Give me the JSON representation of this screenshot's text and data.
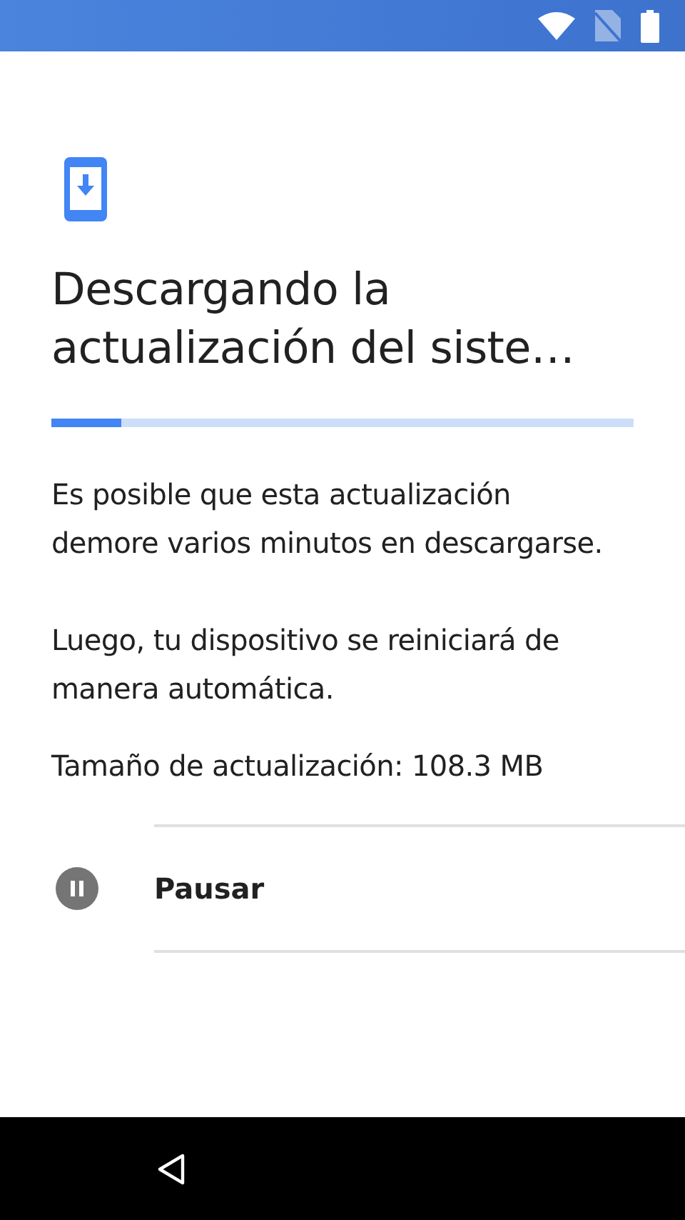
{
  "title": "Descargando la actualización del siste…",
  "progress": {
    "level": 0.12
  },
  "paragraphs": [
    "Es posible que esta actualización demore varios minutos en descargarse.",
    "Luego, tu dispositivo se reiniciará de manera automática.",
    "Tamaño de actualización: 108.3 MB"
  ],
  "actions": [
    {
      "kind": "pause",
      "label": "Pausar"
    }
  ]
}
